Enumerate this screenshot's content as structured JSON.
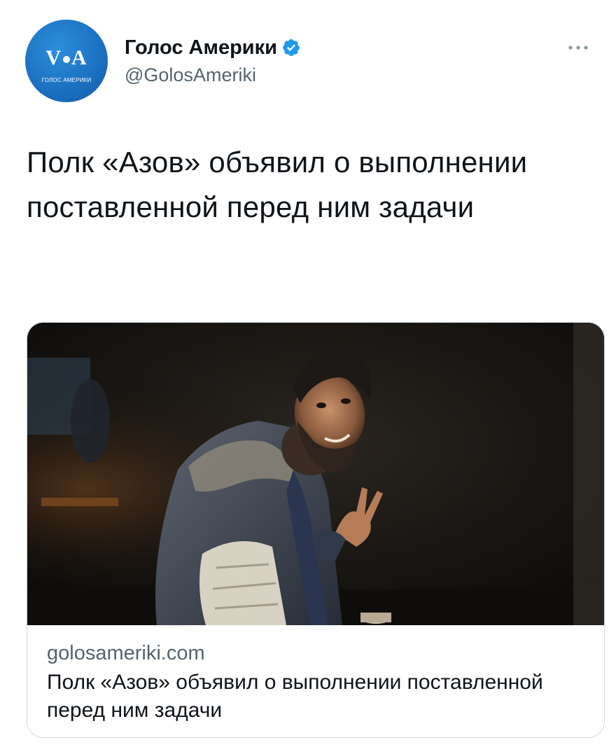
{
  "account": {
    "display_name": "Голос Америки",
    "handle": "@GolosAmeriki",
    "verified": true,
    "avatar_logo_text": "VOA",
    "avatar_sub_text": "ГОЛОС АМЕРИКИ",
    "avatar_color": "#1b6fc0",
    "verified_icon": "verified-badge-icon",
    "verified_color": "#1d9bf0"
  },
  "tweet": {
    "text": "Полк «Азов» объявил о выполнении поставленной перед ним задачи",
    "more_icon": "more-dots-icon"
  },
  "link_card": {
    "image_icon": "photo-soldier-icon",
    "domain": "golosameriki.com",
    "title": "Полк «Азов» объявил о выполнении поставленной перед ним задачи"
  },
  "colors": {
    "text_primary": "#0f1419",
    "text_secondary": "#536471",
    "border": "#cfd9de"
  }
}
